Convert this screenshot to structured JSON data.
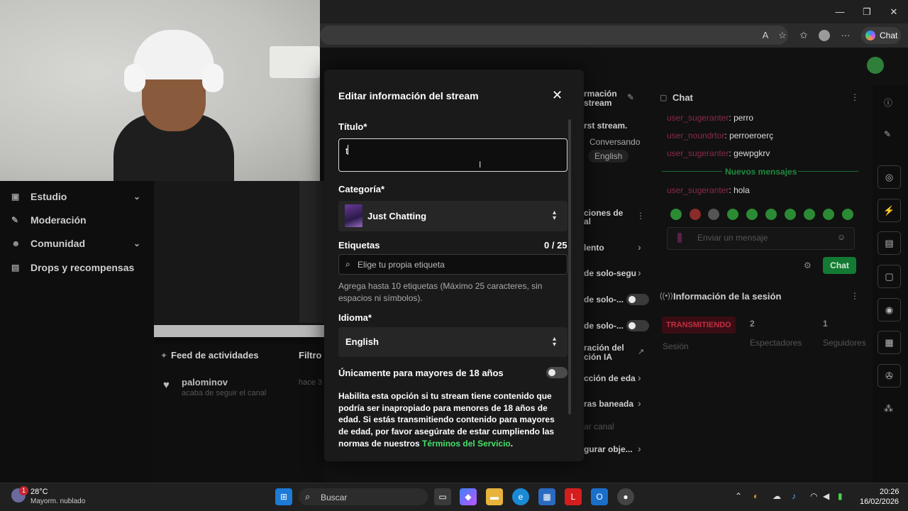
{
  "browser": {
    "chat_button": "Chat",
    "window_controls": [
      "—",
      "❐",
      "✕"
    ],
    "address_icons": [
      "read-aloud-icon",
      "favorite-star-icon",
      "favorites-icon",
      "profile-icon",
      "more-icon"
    ]
  },
  "left_nav": {
    "items": [
      {
        "label": "Estudio",
        "icon": "studio-icon",
        "has_chevron": true
      },
      {
        "label": "Moderación",
        "icon": "wrench-icon",
        "has_chevron": false
      },
      {
        "label": "Comunidad",
        "icon": "people-icon",
        "has_chevron": true
      },
      {
        "label": "Drops y recompensas",
        "icon": "drops-icon",
        "has_chevron": false
      }
    ]
  },
  "activity_feed": {
    "title": "Feed de actividades",
    "filter_label": "Filtro",
    "items": [
      {
        "user": "palominov",
        "text": "acaba de seguir el canal",
        "time": "hace 3"
      }
    ]
  },
  "modal": {
    "title": "Editar información del stream",
    "title_field": {
      "label": "Título*",
      "value": "t"
    },
    "category": {
      "label": "Categoría*",
      "value": "Just Chatting"
    },
    "tags": {
      "label": "Etiquetas",
      "count": "0 / 25",
      "placeholder": "Elige tu propia etiqueta",
      "help": "Agrega hasta 10 etiquetas (Máximo 25 caracteres, sin espacios ni símbolos)."
    },
    "language": {
      "label": "Idioma*",
      "value": "English"
    },
    "mature": {
      "label": "Únicamente para mayores de 18 años",
      "enabled": false,
      "description": "Habilita esta opción si tu stream tiene contenido que podría ser inapropiado para menores de 18 años de edad. Si estás transmitiendo contenido para mayores de edad, por favor asegúrate de estar cumpliendo las normas de nuestros",
      "link": "Términos del Servicio",
      "after_link": "."
    }
  },
  "mid_panel": {
    "stream_info_title": "rmación",
    "stream_info_title2": "stream",
    "stream_title": "rst stream.",
    "category": "Conversando",
    "language": "English",
    "actions_title": "ciones de",
    "actions_title2": "al",
    "items": [
      "lento",
      "de solo-segu",
      "de solo-...",
      "de solo-...",
      "ración del",
      "ción IA",
      "cción de eda",
      "ras baneada",
      "ar canal",
      "gurar obje..."
    ]
  },
  "chat": {
    "title": "Chat",
    "messages": [
      {
        "user": "user_sugeranter",
        "text": "perro"
      },
      {
        "user": "user_noundrtor",
        "text": "perroeroerç"
      },
      {
        "user": "user_sugeranter",
        "text": "gewpgkrv"
      }
    ],
    "new_messages_label": "Nuevos mensajes",
    "after_new": [
      {
        "user": "user_sugeranter",
        "text": "hola"
      }
    ],
    "input_placeholder": "Enviar un mensaje",
    "send_button": "Chat"
  },
  "session": {
    "title": "Información de la sesión",
    "status_badge": "TRANSMITIENDO",
    "status_label": "Sesión",
    "viewers_value": "2",
    "viewers_label": "Espectadores",
    "followers_value": "1",
    "followers_label": "Seguidores"
  },
  "taskbar": {
    "weather_temp": "28°C",
    "weather_desc": "Mayorm. nublado",
    "weather_badge": "1",
    "search_placeholder": "Buscar",
    "time": "20:26",
    "date": "16/02/2026"
  },
  "colors": {
    "accent_green": "#1db954",
    "link_green": "#48e06b",
    "badge_red": "#e0103b",
    "modal_bg": "#1a1a1a"
  }
}
